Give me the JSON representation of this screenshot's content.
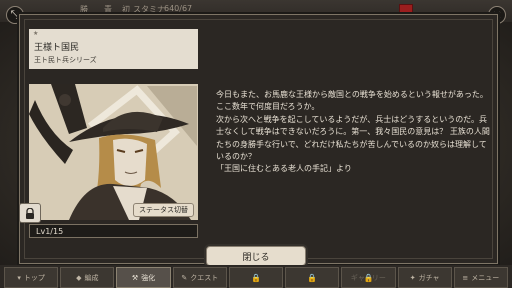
{
  "top_status": {
    "label_1": "勝",
    "label_2": "青",
    "label_3": "初",
    "stamina_label": "スタミナ",
    "stamina_value": "640/67"
  },
  "card": {
    "rarity_star": "★",
    "name": "王様ト国民",
    "series": "王ト民ト兵シリーズ",
    "status_button": "ステータス切替",
    "level": "Lv1/15",
    "lock_icon": "lock-icon"
  },
  "description": "今日もまた、お馬鹿な王様から敵国との戦争を始めるという報せがあった。ここ数年で何度目だろうか。\n次から次へと戦争を起こしているようだが、兵士はどうするというのだ。兵士なくして戦争はできないだろうに。第一、我々国民の意見は？ 王族の人間たちの身勝手な行いで、どれだけ私たちが苦しんでいるのか奴らは理解しているのか？\n「王国に住むとある老人の手記」より",
  "close_button": "閉じる",
  "bottom_nav": [
    {
      "label": "トップ",
      "icon": "▾",
      "state": "normal"
    },
    {
      "label": "編成",
      "icon": "◆",
      "state": "normal"
    },
    {
      "label": "強化",
      "icon": "⚒",
      "state": "active"
    },
    {
      "label": "クエスト",
      "icon": "✎",
      "state": "normal"
    },
    {
      "label": "",
      "icon": "🔒",
      "state": "locked"
    },
    {
      "label": "",
      "icon": "🔒",
      "state": "locked"
    },
    {
      "label": "ギャラリー",
      "icon": "🔒",
      "state": "locked"
    },
    {
      "label": "ガチャ",
      "icon": "✦",
      "state": "normal"
    },
    {
      "label": "メニュー",
      "icon": "≡",
      "state": "normal"
    }
  ],
  "colors": {
    "modal_bg": "#2b2723",
    "plate_bg": "#e4ddd0",
    "text_light": "#e8e1d4"
  }
}
